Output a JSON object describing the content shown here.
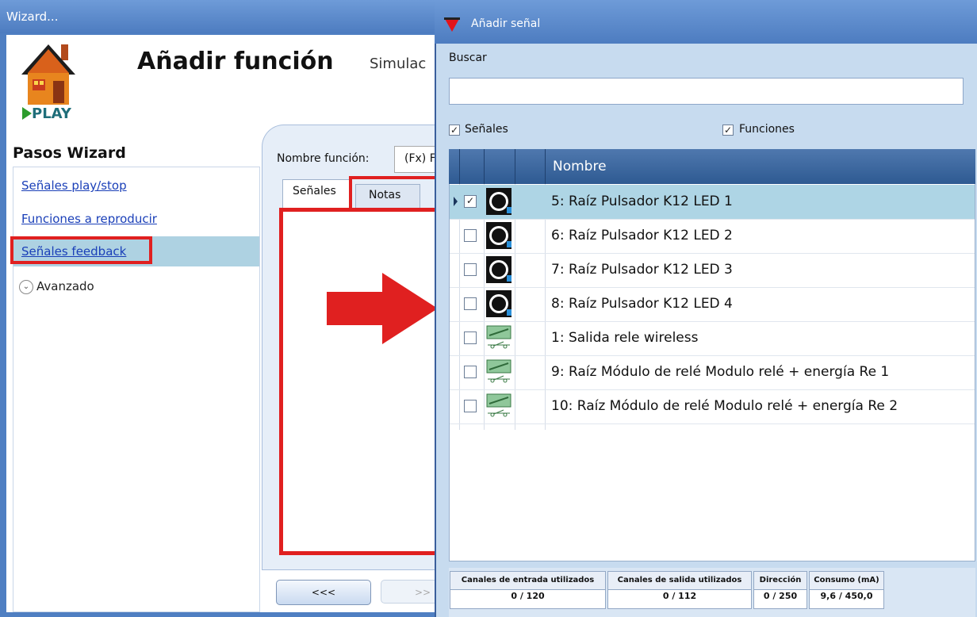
{
  "wizard": {
    "title": "Wizard...",
    "heading": "Añadir función",
    "sub_title": "Simulac",
    "logo_text": "PLAY",
    "steps_title": "Pasos Wizard",
    "steps": [
      {
        "label": "Señales play/stop"
      },
      {
        "label": "Funciones a reproducir"
      },
      {
        "label": "Señales feedback"
      }
    ],
    "avanzado": "Avanzado",
    "function_name_label": "Nombre función:",
    "function_name_value": "(Fx) F",
    "tabs": [
      {
        "label": "Señales"
      },
      {
        "label": "Notas"
      }
    ],
    "prev_button": "<<<",
    "next_button": ">>"
  },
  "signal_window": {
    "title": "Añadir señal",
    "search_label": "Buscar",
    "search_value": "",
    "filter_signals": {
      "label": "Señales",
      "checked": true
    },
    "filter_functions": {
      "label": "Funciones",
      "checked": true
    },
    "column_name": "Nombre",
    "rows": [
      {
        "name": "5: Raíz Pulsador K12 LED 1",
        "checked": true,
        "icon": "button-icon"
      },
      {
        "name": "6: Raíz Pulsador K12 LED 2",
        "checked": false,
        "icon": "button-icon"
      },
      {
        "name": "7: Raíz Pulsador K12 LED 3",
        "checked": false,
        "icon": "button-icon"
      },
      {
        "name": "8: Raíz Pulsador K12 LED 4",
        "checked": false,
        "icon": "button-icon"
      },
      {
        "name": "1: Salida rele wireless",
        "checked": false,
        "icon": "relay-icon"
      },
      {
        "name": "9: Raíz Módulo de relé Modulo relé + energía Re 1",
        "checked": false,
        "icon": "relay-icon"
      },
      {
        "name": "10: Raíz Módulo de relé Modulo relé + energía Re 2",
        "checked": false,
        "icon": "relay-icon"
      }
    ],
    "status": [
      {
        "label": "Canales de entrada utilizados",
        "value": "0 / 120"
      },
      {
        "label": "Canales de salida utilizados",
        "value": "0 / 112"
      },
      {
        "label": "Dirección",
        "value": "0 / 250"
      },
      {
        "label": "Consumo (mA)",
        "value": "9,6 / 450,0"
      }
    ]
  },
  "colors": {
    "highlight_red": "#e02020",
    "selection": "#aed5e5",
    "header_blue": "#2e5a92"
  }
}
